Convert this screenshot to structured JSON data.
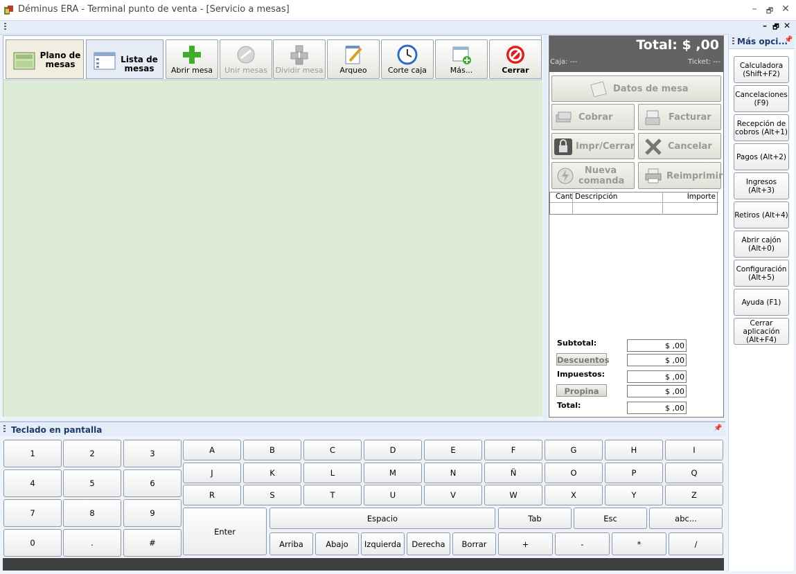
{
  "window": {
    "title": "Déminus ERA - Terminal punto de venta - [Servicio a mesas]",
    "min": "–",
    "restore": "🗗",
    "close": "✕"
  },
  "mdi": {
    "min": "–",
    "restore": "🗗",
    "close": "✕"
  },
  "toolbar": {
    "plano": "Plano de mesas",
    "lista": "Lista de mesas",
    "abrir": "Abrir mesa",
    "unir": "Unir mesas",
    "dividir": "Dividir mesa",
    "arqueo": "Arqueo",
    "corte": "Corte caja",
    "mas": "Más...",
    "cerrar": "Cerrar"
  },
  "panel": {
    "total": "Total: $ ,00",
    "caja": "Caja: ---",
    "ticket": "Ticket: ---",
    "datos": "Datos de mesa",
    "cobrar": "Cobrar",
    "facturar": "Facturar",
    "impr": "Impr/Cerrar",
    "cancelar": "Cancelar",
    "nueva": "Nueva comanda",
    "reimprimir": "Reimprimir",
    "cols": {
      "cant": "Cant",
      "desc": "Descripción",
      "imp": "Importe"
    },
    "subtotal_label": "Subtotal:",
    "subtotal": "$ ,00",
    "descuentos_label": "Descuentos",
    "descuentos": "$ ,00",
    "impuestos_label": "Impuestos:",
    "impuestos": "$ ,00",
    "propina_label": "Propina",
    "propina": "$ ,00",
    "total_label": "Total:",
    "total_val": "$ ,00"
  },
  "side": {
    "title": "Más opci...",
    "pin": "📌",
    "buttons": [
      "Calculadora (Shift+F2)",
      "Cancelaciones (F9)",
      "Recepción de cobros (Alt+1)",
      "Pagos (Alt+2)",
      "Ingresos (Alt+3)",
      "Retiros (Alt+4)",
      "Abrir cajón (Alt+0)",
      "Configuración (Alt+5)",
      "Ayuda (F1)",
      "Cerrar aplicación (Alt+F4)"
    ]
  },
  "keyboard": {
    "title": "Teclado en pantalla",
    "numpad": [
      "1",
      "2",
      "3",
      "4",
      "5",
      "6",
      "7",
      "8",
      "9",
      "0",
      ".",
      "#"
    ],
    "row1": [
      "A",
      "B",
      "C",
      "D",
      "E",
      "F",
      "G",
      "H",
      "I"
    ],
    "row2": [
      "J",
      "K",
      "L",
      "M",
      "N",
      "Ñ",
      "O",
      "P",
      "Q"
    ],
    "row3": [
      "R",
      "S",
      "T",
      "U",
      "V",
      "W",
      "X",
      "Y",
      "Z"
    ],
    "enter": "Enter",
    "espacio": "Espacio",
    "tab": "Tab",
    "esc": "Esc",
    "abc": "abc...",
    "arrows": [
      "Arriba",
      "Abajo",
      "Izquierda",
      "Derecha",
      "Borrar"
    ],
    "ops": [
      "+",
      "-",
      "*",
      "/"
    ]
  }
}
